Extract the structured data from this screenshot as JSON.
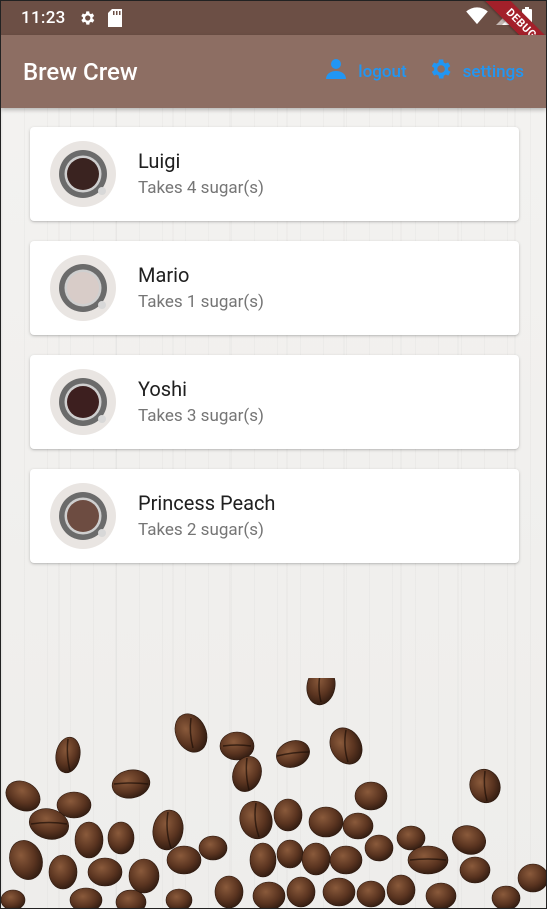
{
  "status_bar": {
    "time": "11:23",
    "debug_label": "DEBUG"
  },
  "app_bar": {
    "title": "Brew Crew",
    "logout_label": "logout",
    "settings_label": "settings",
    "background": "#8d6e63",
    "action_color": "#2196f3"
  },
  "brews": [
    {
      "name": "Luigi",
      "sugars": "Takes 4 sugar(s)",
      "coffee_color": "#3a2320"
    },
    {
      "name": "Mario",
      "sugars": "Takes 1 sugar(s)",
      "coffee_color": "#d8ccc8"
    },
    {
      "name": "Yoshi",
      "sugars": "Takes 3 sugar(s)",
      "coffee_color": "#3d1f1f"
    },
    {
      "name": "Princess Peach",
      "sugars": "Takes 2 sugar(s)",
      "coffee_color": "#6d4c41"
    }
  ]
}
